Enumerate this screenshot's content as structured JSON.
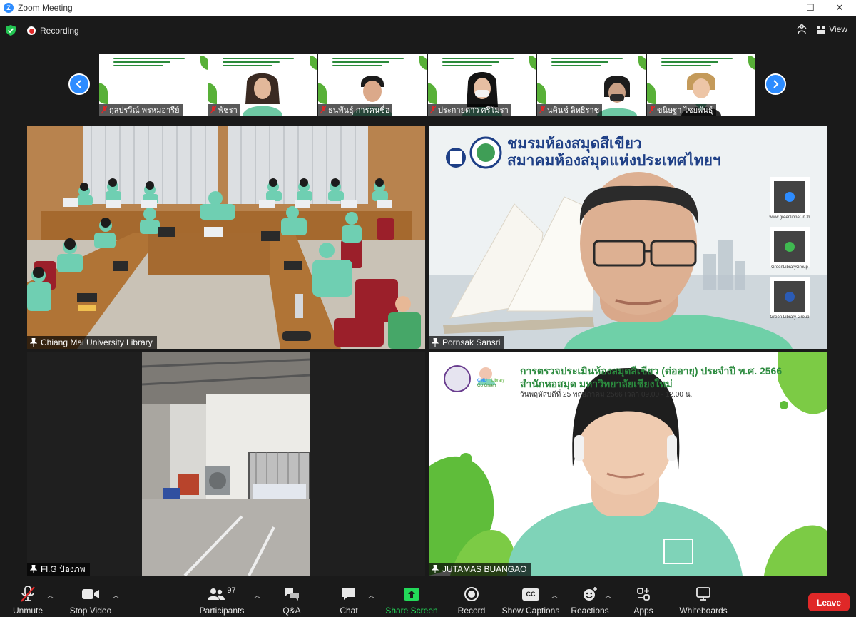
{
  "window": {
    "title": "Zoom Meeting",
    "minimize": "—",
    "maximize": "☐",
    "close": "✕"
  },
  "status": {
    "recording": "Recording",
    "view": "View"
  },
  "thumbnails": [
    {
      "name": "กุลปรวีณ์ พรหมอารีย์"
    },
    {
      "name": "พัชรา"
    },
    {
      "name": "ธนพันธุ์ การคนซื่อ"
    },
    {
      "name": "ประกายดาว ศรีโมรา"
    },
    {
      "name": "นคินช์ ลิทธิราช"
    },
    {
      "name": "ขนิษฐา ไชยพันธุ์"
    }
  ],
  "tiles": {
    "cmu": {
      "name": "Chiang Mai University Library"
    },
    "pornsak": {
      "name": "Pornsak Sansri",
      "banner_line1": "ชมรมห้องสมุดสีเขียว",
      "banner_line2": "สมาคมห้องสมุดแห่งประเทศไทยฯ",
      "qr1": "www.greenlibnet.in.th",
      "qr2": "GreenLibraryGroup",
      "qr3": "Green Library Group"
    },
    "flg": {
      "name": "Fl.G ป้องภพ"
    },
    "jutamas": {
      "name": "JUTAMAS BUANGAO",
      "title1": "การตรวจประเมินห้องสมุดสีเขียว (ต่ออายุ) ประจำปี พ.ศ. 2566",
      "title2": "สำนักหอสมุด มหาวิทยาลัยเชียงใหม่",
      "title3": "วันพฤหัสบดีที่ 25 พฤษภาคม 2566 เวลา 09.00 - 12.00 น.",
      "cmu_logo1": "CMU",
      "cmu_logo2": "Library",
      "cmu_logo3": "Go Green"
    }
  },
  "toolbar": {
    "unmute": "Unmute",
    "stop_video": "Stop Video",
    "participants": "Participants",
    "participants_count": "97",
    "qa": "Q&A",
    "chat": "Chat",
    "share_screen": "Share Screen",
    "record": "Record",
    "show_captions": "Show Captions",
    "cc": "CC",
    "reactions": "Reactions",
    "apps": "Apps",
    "whiteboards": "Whiteboards",
    "leave": "Leave"
  },
  "colors": {
    "accent": "#2d8cff",
    "share": "#23d959",
    "leave": "#e02828",
    "mint": "#7fd3b8"
  }
}
